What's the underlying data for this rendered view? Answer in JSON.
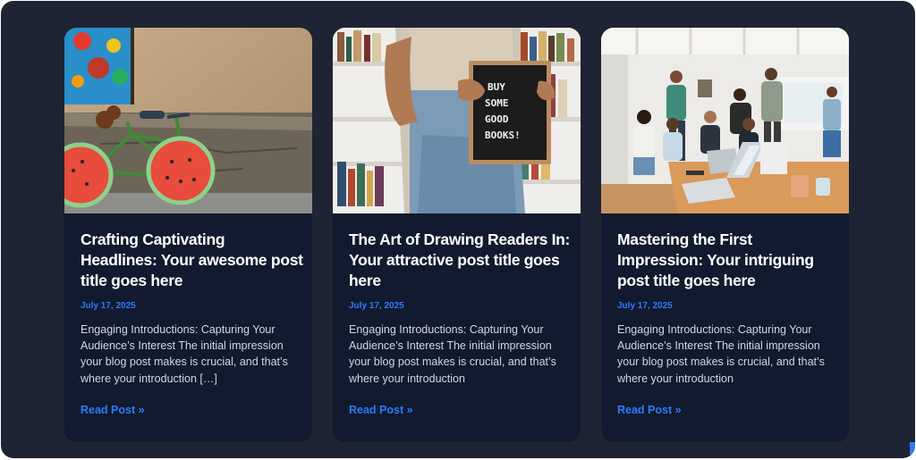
{
  "posts": [
    {
      "image": "bicycle-watermelon-wheels-photo",
      "title": "Crafting Captivating Headlines: Your awesome post title goes here",
      "date": "July 17, 2025",
      "excerpt": "Engaging Introductions: Capturing Your Audience’s Interest The initial impression your blog post makes is crucial, and that’s where your introduction […]",
      "read_more": "Read Post »"
    },
    {
      "image": "letterboard-buy-some-good-books-photo",
      "image_sign_text": [
        "BUY",
        "SOME",
        "GOOD",
        "BOOKS!"
      ],
      "title": "The Art of Drawing Readers In: Your attractive post title goes here",
      "date": "July 17, 2025",
      "excerpt": "Engaging Introductions: Capturing Your Audience’s Interest The initial impression your blog post makes is crucial, and that’s where your introduction",
      "read_more": "Read Post »"
    },
    {
      "image": "team-meeting-office-photo",
      "title": "Mastering the First Impression: Your intriguing post title goes here",
      "date": "July 17, 2025",
      "excerpt": "Engaging Introductions: Capturing Your Audience’s Interest The initial impression your blog post makes is crucial, and that’s where your introduction",
      "read_more": "Read Post »"
    }
  ],
  "colors": {
    "background": "#1e2433",
    "card": "#111a2e",
    "accent": "#2f7bff",
    "title": "#ffffff",
    "body_text": "#d3d7df"
  }
}
